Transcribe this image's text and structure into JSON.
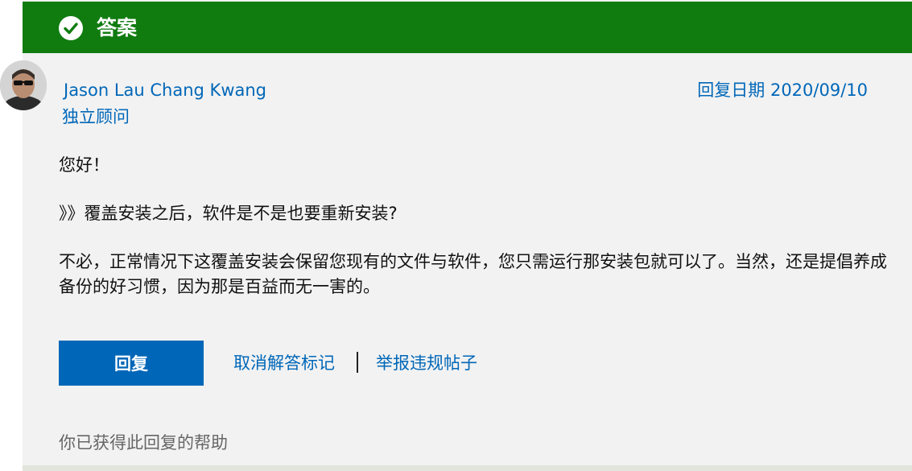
{
  "banner": {
    "title": "答案",
    "icon": "check-circle-icon",
    "color": "#107c10"
  },
  "author": {
    "name": "Jason Lau Chang Kwang",
    "role": "独立顾问",
    "avatar": "avatar-photo"
  },
  "reply_date": "回复日期 2020/09/10",
  "body": {
    "p1": "您好！",
    "p2": "》》覆盖安装之后，软件是不是也要重新安装?",
    "p3": "不必，正常情况下这覆盖安装会保留您现有的文件与软件，您只需运行那安装包就可以了。当然，还是提倡养成备份的好习惯，因为那是百益而无一害的。"
  },
  "actions": {
    "reply": "回复",
    "unmark": "取消解答标记",
    "report": "举报违规帖子"
  },
  "helpful": "你已获得此回复的帮助",
  "colors": {
    "accent": "#0067b8",
    "background": "#f2f2f2"
  }
}
